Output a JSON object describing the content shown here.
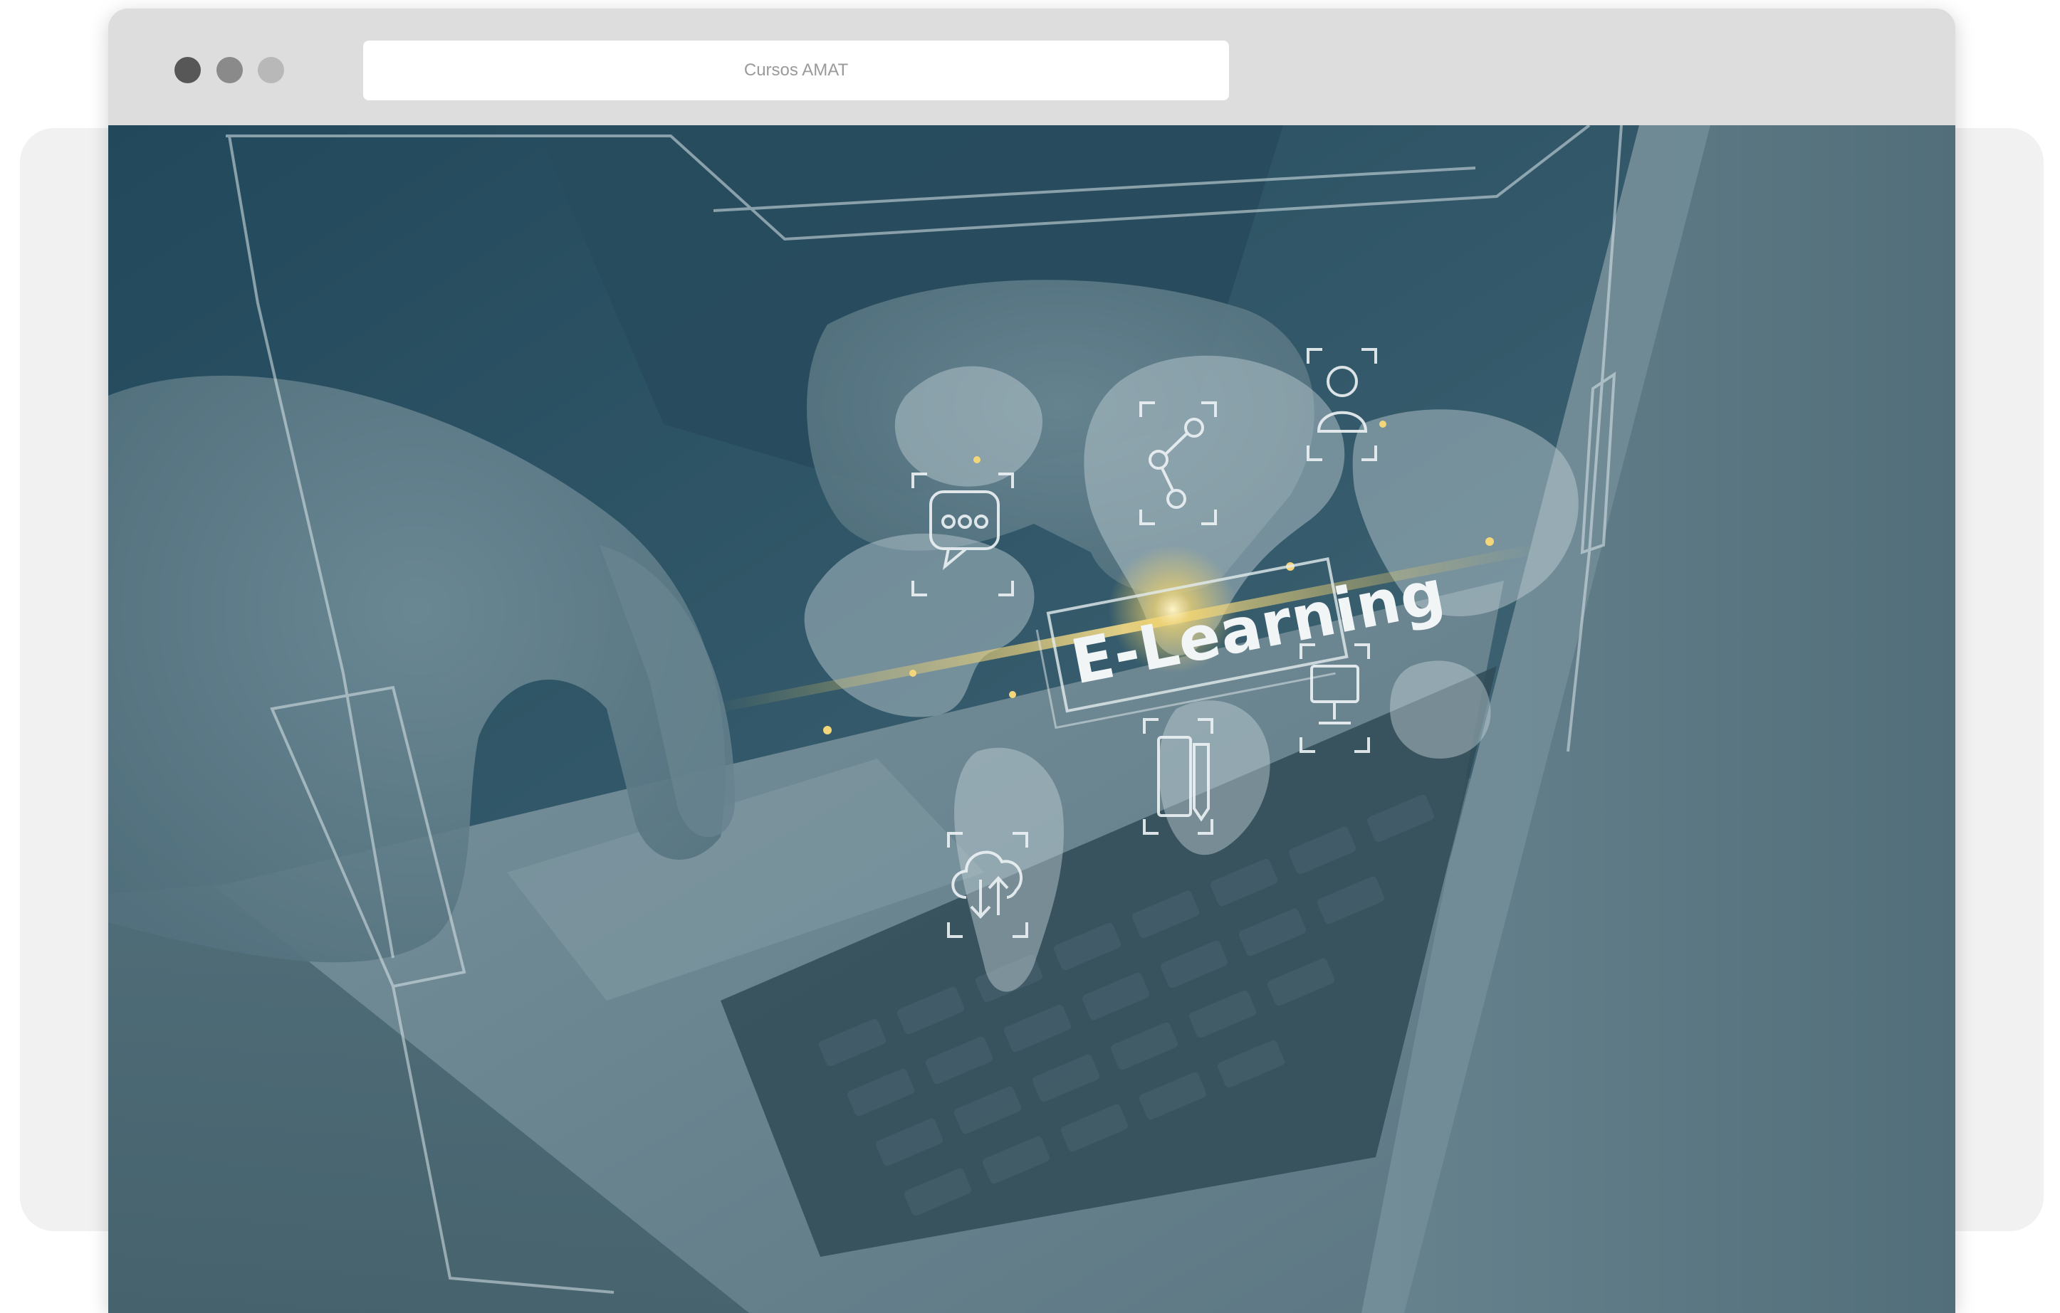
{
  "window": {
    "address_text": "Cursos AMAT",
    "traffic_light_colors": [
      "#575757",
      "#8a8a8a",
      "#b8b8b8"
    ]
  },
  "hero": {
    "overlay_text": "E-Learning",
    "overlay_tint": "#1f4a5e",
    "icons": [
      "chat-bubble-icon",
      "network-nodes-icon",
      "user-profile-icon",
      "monitor-icon",
      "documents-icon",
      "cloud-sync-icon",
      "world-map-icon"
    ]
  }
}
